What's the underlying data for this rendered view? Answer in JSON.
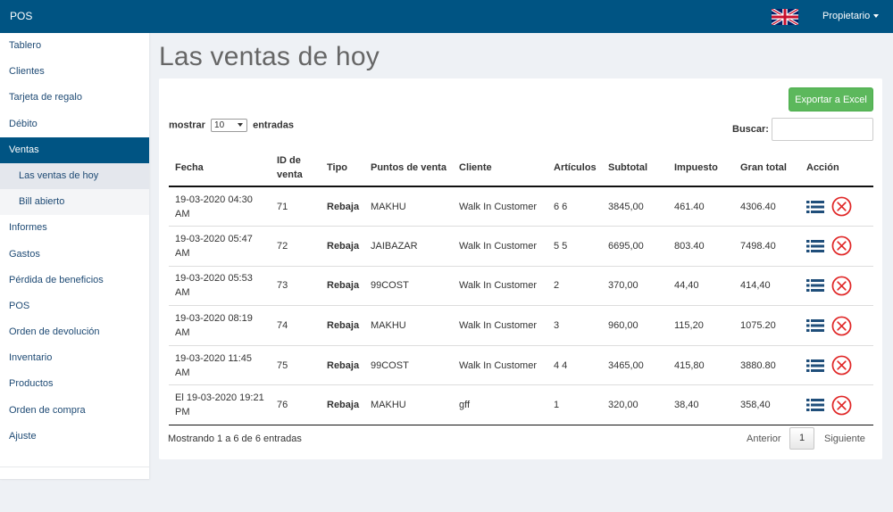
{
  "header": {
    "brand": "POS",
    "user_menu": "Propietario",
    "language_flag": "uk-flag-icon"
  },
  "sidebar": {
    "items": [
      {
        "label": "Tablero"
      },
      {
        "label": "Clientes"
      },
      {
        "label": "Tarjeta de regalo"
      },
      {
        "label": "Débito"
      },
      {
        "label": "Ventas"
      },
      {
        "label": "Las ventas de hoy"
      },
      {
        "label": "Bill abierto"
      },
      {
        "label": "Informes"
      },
      {
        "label": "Gastos"
      },
      {
        "label": "Pérdida de beneficios"
      },
      {
        "label": "POS"
      },
      {
        "label": "Orden de devolución"
      },
      {
        "label": "Inventario"
      },
      {
        "label": "Productos"
      },
      {
        "label": "Orden de compra"
      },
      {
        "label": "Ajuste"
      }
    ]
  },
  "page": {
    "title": "Las ventas de hoy"
  },
  "toolbar": {
    "export_label": "Exportar a Excel"
  },
  "length": {
    "prefix": "mostrar",
    "value": "10",
    "suffix": "entradas"
  },
  "search": {
    "label": "Buscar:",
    "value": "",
    "placeholder": ""
  },
  "table": {
    "columns": [
      "Fecha",
      "ID de venta",
      "Tipo",
      "Puntos de venta",
      "Cliente",
      "Artículos",
      "Subtotal",
      "Impuesto",
      "Gran total",
      "Acción"
    ],
    "rows": [
      {
        "fecha": "19-03-2020 04:30 AM",
        "id": "71",
        "tipo": "Rebaja",
        "punto": "MAKHU",
        "cliente": "Walk In Customer",
        "articulos": "6 6",
        "subtotal": "3845,00",
        "impuesto": "461.40",
        "total": "4306.40"
      },
      {
        "fecha": "19-03-2020 05:47 AM",
        "id": "72",
        "tipo": "Rebaja",
        "punto": "JAIBAZAR",
        "cliente": "Walk In Customer",
        "articulos": "5 5",
        "subtotal": "6695,00",
        "impuesto": "803.40",
        "total": "7498.40"
      },
      {
        "fecha": "19-03-2020 05:53 AM",
        "id": "73",
        "tipo": "Rebaja",
        "punto": "99COST",
        "cliente": "Walk In Customer",
        "articulos": "2",
        "subtotal": "370,00",
        "impuesto": "44,40",
        "total": "414,40"
      },
      {
        "fecha": "19-03-2020 08:19 AM",
        "id": "74",
        "tipo": "Rebaja",
        "punto": "MAKHU",
        "cliente": "Walk In Customer",
        "articulos": "3",
        "subtotal": "960,00",
        "impuesto": "115,20",
        "total": "1075.20"
      },
      {
        "fecha": "19-03-2020 11:45 AM",
        "id": "75",
        "tipo": "Rebaja",
        "punto": "99COST",
        "cliente": "Walk In Customer",
        "articulos": "4 4",
        "subtotal": "3465,00",
        "impuesto": "415,80",
        "total": "3880.80"
      },
      {
        "fecha": "El 19-03-2020 19:21 PM",
        "id": "76",
        "tipo": "Rebaja",
        "punto": "MAKHU",
        "cliente": "gff",
        "articulos": "1",
        "subtotal": "320,00",
        "impuesto": "38,40",
        "total": "358,40"
      }
    ],
    "action_icons": [
      "list-icon",
      "delete-circle-icon"
    ]
  },
  "footer": {
    "info": "Mostrando 1 a 6 de 6 entradas",
    "prev": "Anterior",
    "page": "1",
    "next": "Siguiente"
  },
  "colors": {
    "header_bg": "#005483",
    "export_green": "#5cb85c",
    "list_icon": "#1f4e7a",
    "delete_red": "#e02626"
  }
}
